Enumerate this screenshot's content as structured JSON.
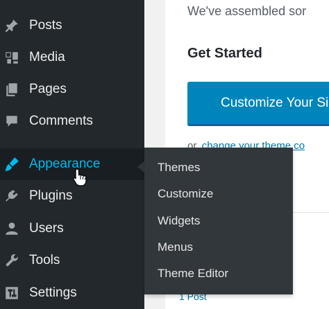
{
  "sidebar": {
    "items": [
      {
        "label": "Posts",
        "icon": "pushpin-icon"
      },
      {
        "label": "Media",
        "icon": "media-icon"
      },
      {
        "label": "Pages",
        "icon": "pages-icon"
      },
      {
        "label": "Comments",
        "icon": "comment-icon"
      },
      {
        "label": "Appearance",
        "icon": "paintbrush-icon",
        "active": true
      },
      {
        "label": "Plugins",
        "icon": "plugin-icon"
      },
      {
        "label": "Users",
        "icon": "user-icon"
      },
      {
        "label": "Tools",
        "icon": "wrench-icon"
      },
      {
        "label": "Settings",
        "icon": "settings-icon"
      }
    ]
  },
  "submenu": {
    "items": [
      "Themes",
      "Customize",
      "Widgets",
      "Menus",
      "Theme Editor"
    ]
  },
  "content": {
    "intro_text": "We've assembled sor",
    "heading": "Get Started",
    "customize_button": "Customize Your Si",
    "or_text": "or,",
    "change_theme_link": "change your theme co",
    "post_hint": "1 Post"
  },
  "colors": {
    "sidebar_bg": "#23282d",
    "submenu_bg": "#32373c",
    "active_text": "#00b9eb",
    "button_bg": "#0085ba",
    "link": "#0073aa"
  }
}
